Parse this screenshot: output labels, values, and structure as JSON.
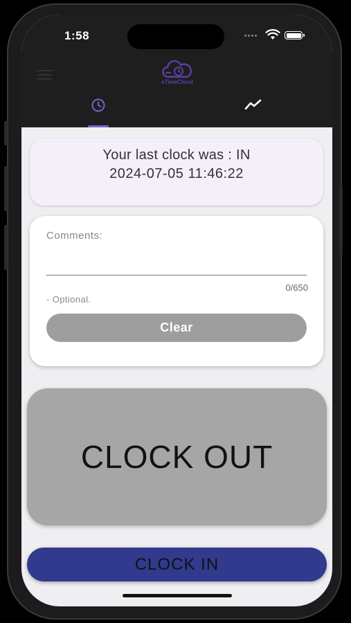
{
  "status_bar": {
    "time": "1:58"
  },
  "header": {
    "logo_text": "eTimeCloud",
    "brand_color": "#5b3fa8"
  },
  "tabs": [
    {
      "icon": "clock-icon",
      "active": true
    },
    {
      "icon": "chart-trend-icon",
      "active": false
    }
  ],
  "last_clock": {
    "line1": "Your last clock was : IN",
    "line2": "2024-07-05 11:46:22"
  },
  "comments": {
    "label": "Comments:",
    "value": "",
    "char_count": "0/650",
    "helper": "- Optional.",
    "clear_label": "Clear"
  },
  "actions": {
    "clock_out_label": "CLOCK OUT",
    "clock_in_label": "CLOCK IN"
  },
  "colors": {
    "clock_in_bg": "#323a8e",
    "clock_out_bg": "#a6a6a6",
    "clear_bg": "#9e9e9e",
    "tab_active": "#7a5fd0"
  }
}
